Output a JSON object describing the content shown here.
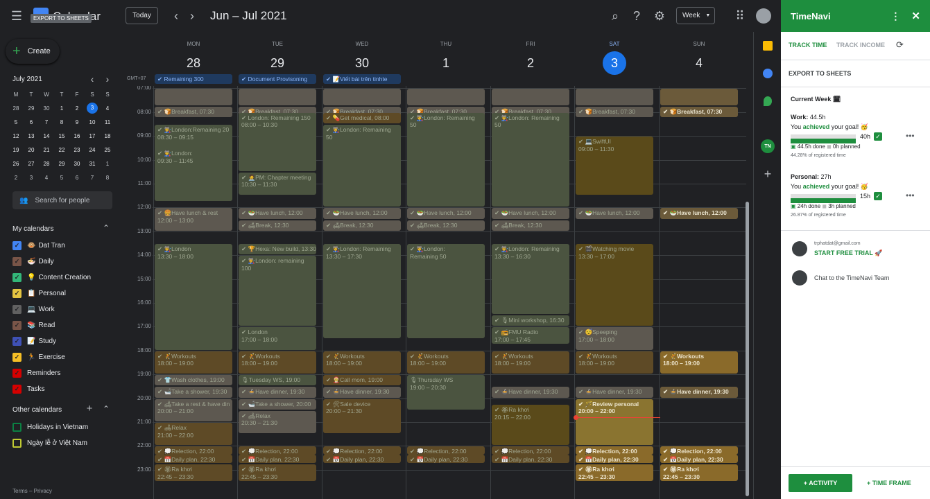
{
  "topbar": {
    "app_title": "Calendar",
    "tooltip": "EXPORT TO SHEETS",
    "today": "Today",
    "date_range": "Jun – Jul 2021",
    "view": "Week"
  },
  "left": {
    "create": "Create",
    "mini_month": "July 2021",
    "weekdays": [
      "M",
      "T",
      "W",
      "T",
      "F",
      "S",
      "S"
    ],
    "mini_weeks": [
      [
        "28",
        "29",
        "30",
        "1",
        "2",
        "3",
        "4"
      ],
      [
        "5",
        "6",
        "7",
        "8",
        "9",
        "10",
        "11"
      ],
      [
        "12",
        "13",
        "14",
        "15",
        "16",
        "17",
        "18"
      ],
      [
        "19",
        "20",
        "21",
        "22",
        "23",
        "24",
        "25"
      ],
      [
        "26",
        "27",
        "28",
        "29",
        "30",
        "31",
        "1"
      ],
      [
        "2",
        "3",
        "4",
        "5",
        "6",
        "7",
        "8"
      ]
    ],
    "search_people": "Search for people",
    "my_calendars": "My calendars",
    "calendars": [
      {
        "name": "Dat Tran",
        "emoji": "🐵",
        "color": "#4285f4"
      },
      {
        "name": "Daily",
        "emoji": "🍜",
        "color": "#795548"
      },
      {
        "name": "Content Creation",
        "emoji": "💡",
        "color": "#33b679"
      },
      {
        "name": "Personal",
        "emoji": "📋",
        "color": "#e4c441"
      },
      {
        "name": "Work",
        "emoji": "💻",
        "color": "#616161"
      },
      {
        "name": "Read",
        "emoji": "📚",
        "color": "#795548"
      },
      {
        "name": "Study",
        "emoji": "📝",
        "color": "#3f51b5"
      },
      {
        "name": "Exercise",
        "emoji": "🏃",
        "color": "#f6bf26"
      },
      {
        "name": "Reminders",
        "emoji": "",
        "color": "#d50000"
      },
      {
        "name": "Tasks",
        "emoji": "",
        "color": "#d50000"
      }
    ],
    "other_calendars": "Other calendars",
    "others": [
      {
        "name": "Holidays in Vietnam",
        "color": "#0b8043"
      },
      {
        "name": "Ngày lễ ở Việt Nam",
        "color": "#c0ca33"
      }
    ],
    "terms": "Terms – Privacy"
  },
  "days": [
    {
      "dow": "MON",
      "num": "28"
    },
    {
      "dow": "TUE",
      "num": "29"
    },
    {
      "dow": "WED",
      "num": "30"
    },
    {
      "dow": "THU",
      "num": "1"
    },
    {
      "dow": "FRI",
      "num": "2"
    },
    {
      "dow": "SAT",
      "num": "3"
    },
    {
      "dow": "SUN",
      "num": "4"
    }
  ],
  "timezone": "GMT+07",
  "hours": [
    "07:00",
    "08:00",
    "09:00",
    "10:00",
    "11:00",
    "12:00",
    "13:00",
    "14:00",
    "15:00",
    "16:00",
    "17:00",
    "18:00",
    "19:00",
    "20:00",
    "21:00",
    "22:00",
    "23:00"
  ],
  "allday": [
    "Remaining 300",
    "Document Provisoning",
    "📝Viết bài trên tinhte"
  ],
  "events": [
    {
      "d": 0,
      "s": 7.0,
      "e": 7.75,
      "t": "",
      "c": "#5d5850"
    },
    {
      "d": 1,
      "s": 7.0,
      "e": 7.75,
      "t": "",
      "c": "#5d5850"
    },
    {
      "d": 2,
      "s": 7.0,
      "e": 7.75,
      "t": "",
      "c": "#5d5850"
    },
    {
      "d": 3,
      "s": 7.0,
      "e": 7.75,
      "t": "",
      "c": "#5d5850"
    },
    {
      "d": 4,
      "s": 7.0,
      "e": 7.75,
      "t": "",
      "c": "#5d5850"
    },
    {
      "d": 5,
      "s": 7.0,
      "e": 7.75,
      "t": "",
      "c": "#5d5850"
    },
    {
      "d": 6,
      "s": 7.0,
      "e": 7.75,
      "t": "",
      "c": "#6b5a3a"
    },
    {
      "d": 0,
      "s": 7.75,
      "e": 8.25,
      "t": "✔ 🍞Breakfast, 07:30",
      "c": "#5d5850"
    },
    {
      "d": 1,
      "s": 7.75,
      "e": 8.25,
      "t": "✔ 🍞Breakfast, 07:30",
      "c": "#5d5850"
    },
    {
      "d": 2,
      "s": 7.75,
      "e": 8.25,
      "t": "✔ 🍞Breakfast, 07:30",
      "c": "#5d5850"
    },
    {
      "d": 3,
      "s": 7.75,
      "e": 8.25,
      "t": "✔ 🍞Breakfast, 07:30",
      "c": "#5d5850"
    },
    {
      "d": 4,
      "s": 7.75,
      "e": 8.25,
      "t": "✔ 🍞Breakfast, 07:30",
      "c": "#5d5850"
    },
    {
      "d": 5,
      "s": 7.75,
      "e": 8.25,
      "t": "✔ 🍞Breakfast, 07:30",
      "c": "#5d5850"
    },
    {
      "d": 6,
      "s": 7.75,
      "e": 8.25,
      "t": "✔ 🍞Breakfast, 07:30",
      "c": "#6b5a3a",
      "bright": true
    },
    {
      "d": 0,
      "s": 8.5,
      "e": 11.75,
      "t": "✔ 👩‍🏭London:Remaining 20",
      "t2": "08:30 – 09:15",
      "c": "#4b5440"
    },
    {
      "d": 0,
      "s": 9.5,
      "e": 11.75,
      "t": "✔ 👩‍🏭London:",
      "t2": "09:30 – 11:45",
      "c": "#4b5440"
    },
    {
      "d": 1,
      "s": 8.0,
      "e": 10.5,
      "t": "✔ London: Remaining 150",
      "t2": "08:00 – 10:30",
      "c": "#4b5440"
    },
    {
      "d": 1,
      "s": 10.5,
      "e": 11.5,
      "t": "✔ 🧑‍💼PM: Chapter meeting",
      "t2": "10:30 – 11:30",
      "c": "#4b5440"
    },
    {
      "d": 2,
      "s": 8.0,
      "e": 8.5,
      "t": "✔ 💊Get medical, 08:00",
      "c": "#5e4a26"
    },
    {
      "d": 2,
      "s": 8.5,
      "e": 12.0,
      "t": "✔ 👩‍🏭London: Remaining",
      "t2": "50",
      "c": "#4b5440"
    },
    {
      "d": 3,
      "s": 8.0,
      "e": 12.0,
      "t": "✔ 👩‍🏭London: Remaining",
      "t2": "50",
      "c": "#4b5440"
    },
    {
      "d": 4,
      "s": 8.0,
      "e": 12.0,
      "t": "✔ 👩‍🏭London: Remaining",
      "t2": "50",
      "c": "#4b5440"
    },
    {
      "d": 5,
      "s": 9.0,
      "e": 11.5,
      "t": "✔ 💻SwiftUI",
      "t2": "09:00 – 11:30",
      "c": "#5a4a1a"
    },
    {
      "d": 0,
      "s": 12.0,
      "e": 13.0,
      "t": "✔ 🍔Have lunch & rest",
      "t2": "12:00 – 13:00",
      "c": "#5d5850"
    },
    {
      "d": 1,
      "s": 12.0,
      "e": 12.5,
      "t": "✔ 🥗Have lunch, 12:00",
      "c": "#5d5850"
    },
    {
      "d": 2,
      "s": 12.0,
      "e": 12.5,
      "t": "✔ 🥗Have lunch, 12:00",
      "c": "#5d5850"
    },
    {
      "d": 3,
      "s": 12.0,
      "e": 12.5,
      "t": "✔ 🥗Have lunch, 12:00",
      "c": "#5d5850"
    },
    {
      "d": 4,
      "s": 12.0,
      "e": 12.5,
      "t": "✔ 🥗Have lunch, 12:00",
      "c": "#5d5850"
    },
    {
      "d": 5,
      "s": 12.0,
      "e": 12.5,
      "t": "✔ 🥗Have lunch, 12:00",
      "c": "#5d5850"
    },
    {
      "d": 6,
      "s": 12.0,
      "e": 12.5,
      "t": "✔ 🥗Have lunch, 12:00",
      "c": "#6b5a3a",
      "bright": true
    },
    {
      "d": 1,
      "s": 12.5,
      "e": 13.0,
      "t": "✔ 🛋Break, 12:30",
      "c": "#5d5850"
    },
    {
      "d": 2,
      "s": 12.5,
      "e": 13.0,
      "t": "✔ 🛋Break, 12:30",
      "c": "#5d5850"
    },
    {
      "d": 3,
      "s": 12.5,
      "e": 13.0,
      "t": "✔ 🛋Break, 12:30",
      "c": "#5d5850"
    },
    {
      "d": 4,
      "s": 12.5,
      "e": 13.0,
      "t": "✔ 🛋Break, 12:30",
      "c": "#5d5850"
    },
    {
      "d": 0,
      "s": 13.5,
      "e": 18.0,
      "t": "✔ 👩‍🏭London",
      "t2": "13:30 – 18:00",
      "c": "#4b5440"
    },
    {
      "d": 1,
      "s": 13.5,
      "e": 14.0,
      "t": "✔ 🏆Hexa: New build, 13:30",
      "c": "#4b5440"
    },
    {
      "d": 1,
      "s": 14.0,
      "e": 17.0,
      "t": "✔ 👩‍🏭London: remaining",
      "t2": "100",
      "c": "#4b5440"
    },
    {
      "d": 1,
      "s": 17.0,
      "e": 18.0,
      "t": "✔ London",
      "t2": "17:00 – 18:00",
      "c": "#4b5440"
    },
    {
      "d": 2,
      "s": 13.5,
      "e": 17.5,
      "t": "✔ 👩‍🏭London: Remaining",
      "t2": "13:30 – 17:30",
      "c": "#4b5440"
    },
    {
      "d": 3,
      "s": 13.5,
      "e": 17.5,
      "t": "✔ 👩‍🏭London:",
      "t2": "Remaining 50",
      "c": "#4b5440"
    },
    {
      "d": 4,
      "s": 13.5,
      "e": 16.5,
      "t": "✔ 👩‍🏭London: Remaining",
      "t2": "13:30 – 16:30",
      "c": "#4b5440"
    },
    {
      "d": 4,
      "s": 16.5,
      "e": 17.0,
      "t": "✔ 🎙Mini workshop, 16:30",
      "c": "#4b5440"
    },
    {
      "d": 4,
      "s": 17.0,
      "e": 17.75,
      "t": "✔ 📻FMU Radio",
      "t2": "17:00 – 17:45",
      "c": "#4b5440"
    },
    {
      "d": 5,
      "s": 13.5,
      "e": 17.0,
      "t": "✔ 🎬Watching movie",
      "t2": "13:30 – 17:00",
      "c": "#5a4a1a"
    },
    {
      "d": 5,
      "s": 17.0,
      "e": 18.0,
      "t": "✔ 😴Speeping",
      "t2": "17:00 – 18:00",
      "c": "#5d5850"
    },
    {
      "d": 0,
      "s": 18.0,
      "e": 19.0,
      "t": "✔ 🤾Workouts",
      "t2": "18:00 – 19:00",
      "c": "#5e4a26"
    },
    {
      "d": 1,
      "s": 18.0,
      "e": 19.0,
      "t": "✔ 🤾Workouts",
      "t2": "18:00 – 19:00",
      "c": "#5e4a26"
    },
    {
      "d": 2,
      "s": 18.0,
      "e": 19.0,
      "t": "✔ 🤾Workouts",
      "t2": "18:00 – 19:00",
      "c": "#5e4a26"
    },
    {
      "d": 3,
      "s": 18.0,
      "e": 19.0,
      "t": "✔ 🤾Workouts",
      "t2": "18:00 – 19:00",
      "c": "#5e4a26"
    },
    {
      "d": 4,
      "s": 18.0,
      "e": 19.0,
      "t": "✔ 🤾Workouts",
      "t2": "18:00 – 19:00",
      "c": "#5e4a26"
    },
    {
      "d": 5,
      "s": 18.0,
      "e": 19.0,
      "t": "✔ 🤾Workouts",
      "t2": "18:00 – 19:00",
      "c": "#5e4a26"
    },
    {
      "d": 6,
      "s": 18.0,
      "e": 19.0,
      "t": "✔ 🤾Workouts",
      "t2": "18:00 – 19:00",
      "c": "#8a6a2a",
      "bright": true
    },
    {
      "d": 0,
      "s": 19.0,
      "e": 19.5,
      "t": "✔ 👕Wash clothes, 19:00",
      "c": "#5d5850"
    },
    {
      "d": 1,
      "s": 19.0,
      "e": 19.5,
      "t": "🎙Tuesday WS, 19:00",
      "c": "#4b5440"
    },
    {
      "d": 2,
      "s": 19.0,
      "e": 19.5,
      "t": "✔ 🤶Call mom, 19:00",
      "c": "#5e4a26"
    },
    {
      "d": 3,
      "s": 19.0,
      "e": 20.5,
      "t": "🎙Thursday WS",
      "t2": "19:00 – 20:30",
      "c": "#4b5440"
    },
    {
      "d": 0,
      "s": 19.5,
      "e": 20.0,
      "t": "✔ 🛁Take a shower, 19:30",
      "c": "#5d5850"
    },
    {
      "d": 1,
      "s": 19.5,
      "e": 20.0,
      "t": "✔ 🍲Have dinner, 19:30",
      "c": "#5d5850"
    },
    {
      "d": 2,
      "s": 19.5,
      "e": 20.0,
      "t": "✔ 🍲Have dinner, 19:30",
      "c": "#5d5850"
    },
    {
      "d": 4,
      "s": 19.5,
      "e": 20.0,
      "t": "✔ 🍲Have dinner, 19:30",
      "c": "#5d5850"
    },
    {
      "d": 5,
      "s": 19.5,
      "e": 20.0,
      "t": "✔ 🍲Have dinner, 19:30",
      "c": "#5d5850"
    },
    {
      "d": 6,
      "s": 19.5,
      "e": 20.0,
      "t": "✔ 🍲Have dinner, 19:30",
      "c": "#6b5a3a",
      "bright": true
    },
    {
      "d": 0,
      "s": 20.0,
      "e": 21.0,
      "t": "✔ 🛋Take a rest & have din",
      "t2": "20:00 – 21:00",
      "c": "#5d5850"
    },
    {
      "d": 1,
      "s": 20.0,
      "e": 20.5,
      "t": "✔ 🛁Take a shower, 20:00",
      "c": "#5d5850"
    },
    {
      "d": 1,
      "s": 20.5,
      "e": 21.5,
      "t": "✔ 🛋Relax",
      "t2": "20:30 – 21:30",
      "c": "#5d5850"
    },
    {
      "d": 2,
      "s": 20.0,
      "e": 21.5,
      "t": "✔ 🛠Sale device",
      "t2": "20:00 – 21:30",
      "c": "#5e4a26"
    },
    {
      "d": 4,
      "s": 20.25,
      "e": 22.0,
      "t": "✔ 🏵Ra khơi",
      "t2": "20:15 – 22:00",
      "c": "#5a4a1a"
    },
    {
      "d": 5,
      "s": 20.0,
      "e": 22.0,
      "t": "✔ 🪄Review personal",
      "t2": "20:00 – 22:00",
      "c": "#8a7430",
      "bright": true
    },
    {
      "d": 0,
      "s": 21.0,
      "e": 22.0,
      "t": "✔ 🛋Relax",
      "t2": "21:00 – 22:00",
      "c": "#5e4a26"
    },
    {
      "d": 0,
      "s": 22.0,
      "e": 22.33,
      "t": "✔ 💭Relection, 22:00",
      "c": "#5e4a26"
    },
    {
      "d": 1,
      "s": 22.0,
      "e": 22.33,
      "t": "✔ 💭Relection, 22:00",
      "c": "#5e4a26"
    },
    {
      "d": 2,
      "s": 22.0,
      "e": 22.33,
      "t": "✔ 💭Relection, 22:00",
      "c": "#5e4a26"
    },
    {
      "d": 3,
      "s": 22.0,
      "e": 22.33,
      "t": "✔ 💭Relection, 22:00",
      "c": "#5e4a26"
    },
    {
      "d": 4,
      "s": 22.0,
      "e": 22.33,
      "t": "✔ 💭Relection, 22:00",
      "c": "#5e4a26"
    },
    {
      "d": 5,
      "s": 22.0,
      "e": 22.33,
      "t": "✔ 💭Relection, 22:00",
      "c": "#8a6a2a",
      "bright": true
    },
    {
      "d": 6,
      "s": 22.0,
      "e": 22.33,
      "t": "✔ 💭Relection, 22:00",
      "c": "#8a6a2a",
      "bright": true
    },
    {
      "d": 0,
      "s": 22.33,
      "e": 22.66,
      "t": "✔ 📅Daily plan, 22:30",
      "c": "#5e4a26"
    },
    {
      "d": 1,
      "s": 22.33,
      "e": 22.66,
      "t": "✔ 📅Daily plan, 22:30",
      "c": "#5e4a26"
    },
    {
      "d": 2,
      "s": 22.33,
      "e": 22.66,
      "t": "✔ 📅Daily plan, 22:30",
      "c": "#5e4a26"
    },
    {
      "d": 3,
      "s": 22.33,
      "e": 22.66,
      "t": "✔ 📅Daily plan, 22:30",
      "c": "#5e4a26"
    },
    {
      "d": 4,
      "s": 22.33,
      "e": 22.66,
      "t": "✔ 📅Daily plan, 22:30",
      "c": "#5e4a26"
    },
    {
      "d": 5,
      "s": 22.33,
      "e": 22.66,
      "t": "✔ 📅Daily plan, 22:30",
      "c": "#8a6a2a",
      "bright": true
    },
    {
      "d": 6,
      "s": 22.33,
      "e": 22.66,
      "t": "✔ 📅Daily plan, 22:30",
      "c": "#8a6a2a",
      "bright": true
    },
    {
      "d": 0,
      "s": 22.75,
      "e": 23.5,
      "t": "✔ 🏵Ra khơi",
      "t2": "22:45 – 23:30",
      "c": "#5e4a26"
    },
    {
      "d": 1,
      "s": 22.75,
      "e": 23.5,
      "t": "✔ 🏵Ra khơi",
      "t2": "22:45 – 23:30",
      "c": "#5e4a26"
    },
    {
      "d": 5,
      "s": 22.75,
      "e": 23.5,
      "t": "✔ 🏵Ra khơi",
      "t2": "22:45 – 23:30",
      "c": "#8a6a2a",
      "bright": true
    },
    {
      "d": 6,
      "s": 22.75,
      "e": 23.5,
      "t": "✔ 🏵Ra khơi",
      "t2": "22:45 – 23:30",
      "c": "#8a6a2a",
      "bright": true
    }
  ],
  "timenavi": {
    "title": "TimeNavi",
    "tab_track_time": "TRACK TIME",
    "tab_track_income": "TRACK INCOME",
    "export": "EXPORT TO SHEETS",
    "current_week": "Current Week",
    "work_label": "Work:",
    "work_hours": "44.5h",
    "achieved_pre": "You",
    "achieved_word": "achieved",
    "achieved_post": "your goal!",
    "work_goal": "40h",
    "work_done": "44.5h done",
    "work_planned": "0h planned",
    "work_pct": "44.28% of registered time",
    "work_fill": 1.0,
    "personal_label": "Personal:",
    "personal_hours": "27h",
    "personal_goal": "15h",
    "personal_done": "24h done",
    "personal_planned": "3h planned",
    "personal_pct": "26.87% of registered time",
    "personal_fill": 1.0,
    "email": "trphatdat@gmail.com",
    "trial": "START FREE TRIAL",
    "chat": "Chat to the TimeNavi Team",
    "activity_btn": "+ ACTIVITY",
    "timeframe_btn": "+ TIME FRAME"
  }
}
